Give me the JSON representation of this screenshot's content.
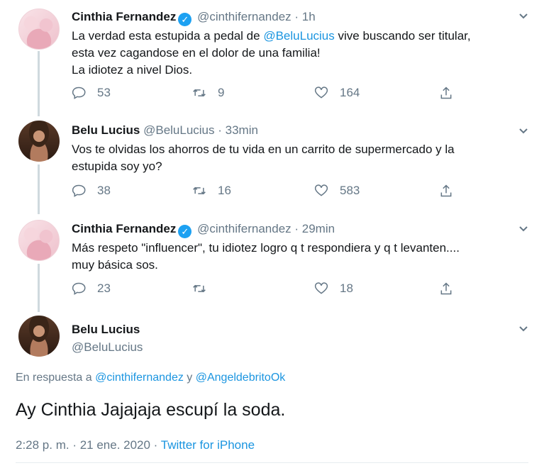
{
  "tweets": [
    {
      "name": "Cinthia Fernandez",
      "handle_time": "@cinthifernandez · 1h",
      "text_lines": [
        "La verdad esta estupida a pedal de ",
        "@BeluLucius",
        " vive buscando ser titular,",
        "esta vez cagandose en el dolor de una familia!",
        "La idiotez a nivel Dios."
      ],
      "replies": "53",
      "retweets": "9",
      "likes": "164"
    },
    {
      "name": "Belu Lucius",
      "handle_time": "@BeluLucius · 33min",
      "text_lines": [
        "Vos te olvidas los ahorros de tu vida en un carrito de supermercado y la",
        "estupida soy yo?"
      ],
      "replies": "38",
      "retweets": "16",
      "likes": "583"
    },
    {
      "name": "Cinthia Fernandez",
      "handle_time": "@cinthifernandez · 29min",
      "text_lines": [
        "Más respeto \"influencer\", tu idiotez logro q t respondiera y q t levanten....",
        "muy básica sos."
      ],
      "replies": "23",
      "retweets": "",
      "likes": "18"
    }
  ],
  "focus": {
    "name": "Belu Lucius",
    "handle": "@BeluLucius",
    "reply_prefix": "En respuesta a ",
    "reply_user1": "@cinthifernandez",
    "reply_join": " y ",
    "reply_user2": "@AngeldebritoOk",
    "text": "Ay Cinthia Jajajaja escupí la soda.",
    "timestamp": "2:28 p. m. · 21 ene. 2020 · ",
    "source": "Twitter for iPhone"
  },
  "icons": {
    "reply": "reply-icon",
    "retweet": "retweet-icon",
    "like": "heart-icon",
    "share": "share-icon",
    "verified": "verified-badge-icon",
    "menu": "chevron-down-icon"
  },
  "colors": {
    "link": "#1b95e0",
    "muted": "#657786",
    "verified": "#1da1f2",
    "thread_line": "#cfd9de"
  }
}
